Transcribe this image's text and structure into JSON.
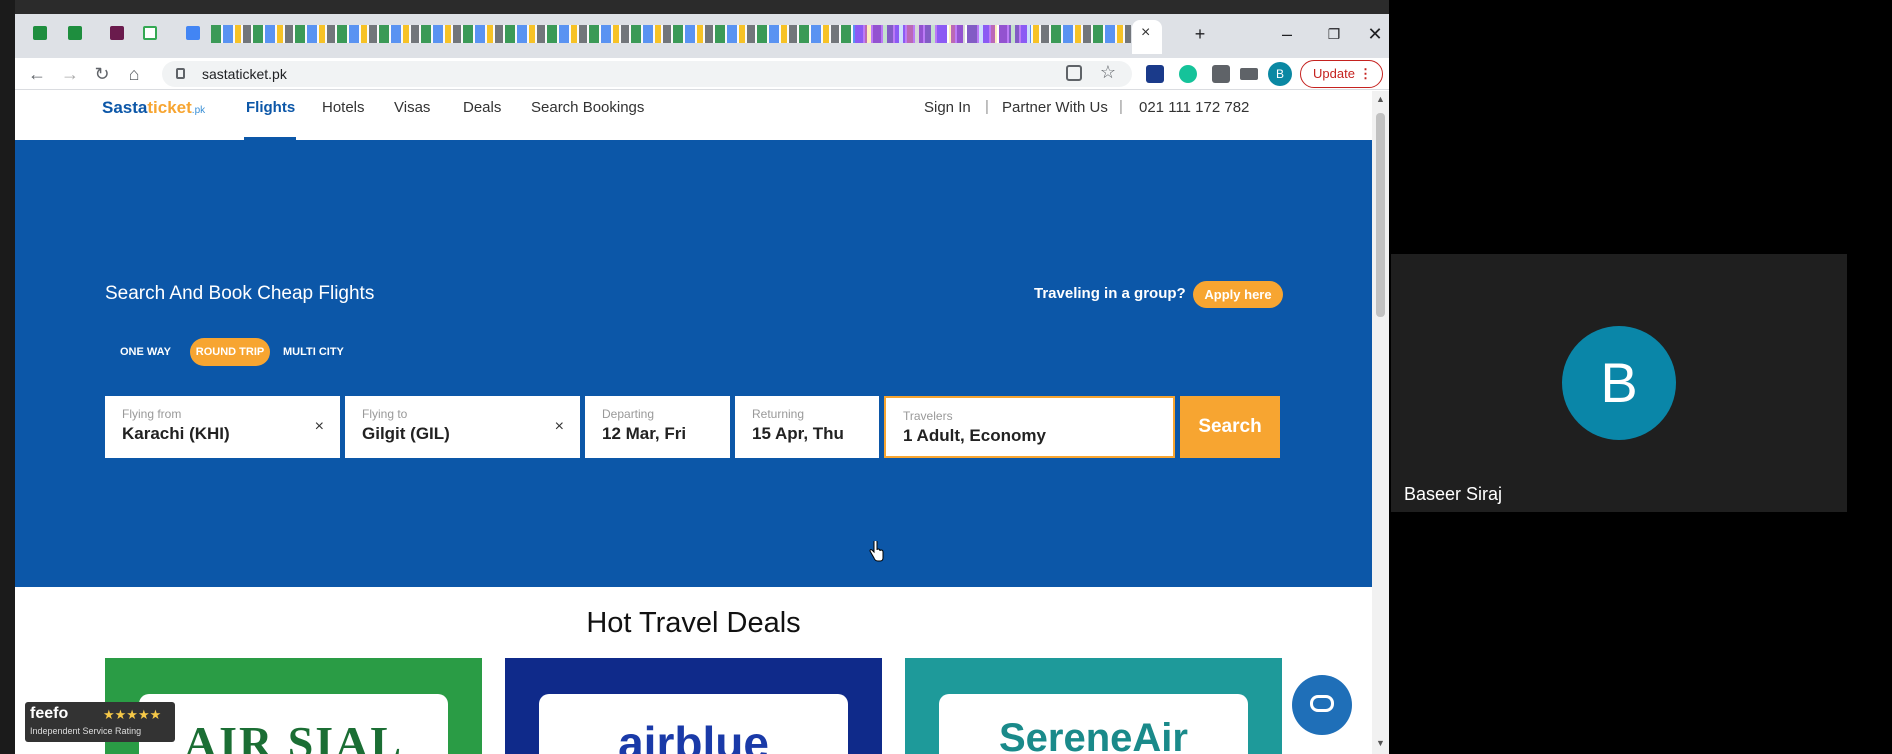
{
  "browser": {
    "url": "sastaticket.pk",
    "update_label": "Update",
    "profile_initial": "B",
    "tab_close": "×",
    "new_tab": "+",
    "window_controls": {
      "minimize": "–",
      "maximize": "❐",
      "close": "✕"
    },
    "nav": {
      "back": "←",
      "forward": "→",
      "reload": "↻",
      "home": "⌂"
    }
  },
  "site": {
    "logo": {
      "main": "Sasta",
      "accent": "ticket",
      "suffix": ".pk"
    },
    "nav": [
      "Flights",
      "Hotels",
      "Visas",
      "Deals",
      "Search Bookings"
    ],
    "right_nav": {
      "sign_in": "Sign In",
      "partner": "Partner With Us",
      "phone": "021 111 172 782",
      "separator": "|"
    }
  },
  "hero": {
    "title": "Search And Book Cheap Flights",
    "group_prompt": "Traveling in a group?",
    "apply_label": "Apply here",
    "trip_types": [
      "ONE WAY",
      "ROUND TRIP",
      "MULTI CITY"
    ],
    "selected_trip_type": "ROUND TRIP"
  },
  "search_form": {
    "from": {
      "label": "Flying from",
      "value": "Karachi (KHI)"
    },
    "to": {
      "label": "Flying to",
      "value": "Gilgit (GIL)"
    },
    "departing": {
      "label": "Departing",
      "value": "12 Mar, Fri"
    },
    "returning": {
      "label": "Returning",
      "value": "15 Apr, Thu"
    },
    "travelers": {
      "label": "Travelers",
      "value": "1 Adult, Economy"
    },
    "clear_symbol": "×",
    "search_label": "Search"
  },
  "deals": {
    "title": "Hot Travel Deals",
    "cards": [
      "AIR SIAL",
      "airblue",
      "SereneAir"
    ]
  },
  "feefo": {
    "name": "feefo",
    "stars": "★★★★★",
    "caption": "Independent Service Rating"
  },
  "call": {
    "participant_initial": "B",
    "participant_name": "Baseer Siraj"
  },
  "colors": {
    "brand_blue": "#0c57a8",
    "accent_orange": "#f7a531",
    "avatar_teal": "#0a86a8"
  }
}
